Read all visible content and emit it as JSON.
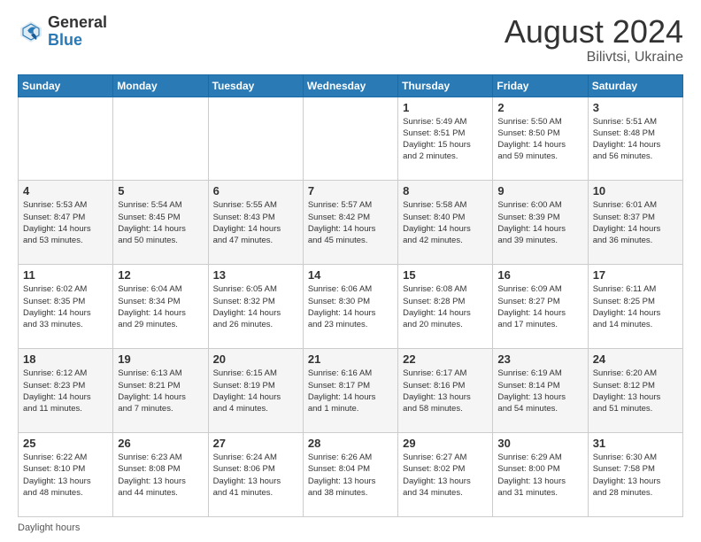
{
  "logo": {
    "general": "General",
    "blue": "Blue"
  },
  "header": {
    "month_year": "August 2024",
    "location": "Bilivtsi, Ukraine"
  },
  "days_of_week": [
    "Sunday",
    "Monday",
    "Tuesday",
    "Wednesday",
    "Thursday",
    "Friday",
    "Saturday"
  ],
  "footer": {
    "daylight_label": "Daylight hours"
  },
  "weeks": [
    [
      {
        "day": "",
        "info": ""
      },
      {
        "day": "",
        "info": ""
      },
      {
        "day": "",
        "info": ""
      },
      {
        "day": "",
        "info": ""
      },
      {
        "day": "1",
        "info": "Sunrise: 5:49 AM\nSunset: 8:51 PM\nDaylight: 15 hours\nand 2 minutes."
      },
      {
        "day": "2",
        "info": "Sunrise: 5:50 AM\nSunset: 8:50 PM\nDaylight: 14 hours\nand 59 minutes."
      },
      {
        "day": "3",
        "info": "Sunrise: 5:51 AM\nSunset: 8:48 PM\nDaylight: 14 hours\nand 56 minutes."
      }
    ],
    [
      {
        "day": "4",
        "info": "Sunrise: 5:53 AM\nSunset: 8:47 PM\nDaylight: 14 hours\nand 53 minutes."
      },
      {
        "day": "5",
        "info": "Sunrise: 5:54 AM\nSunset: 8:45 PM\nDaylight: 14 hours\nand 50 minutes."
      },
      {
        "day": "6",
        "info": "Sunrise: 5:55 AM\nSunset: 8:43 PM\nDaylight: 14 hours\nand 47 minutes."
      },
      {
        "day": "7",
        "info": "Sunrise: 5:57 AM\nSunset: 8:42 PM\nDaylight: 14 hours\nand 45 minutes."
      },
      {
        "day": "8",
        "info": "Sunrise: 5:58 AM\nSunset: 8:40 PM\nDaylight: 14 hours\nand 42 minutes."
      },
      {
        "day": "9",
        "info": "Sunrise: 6:00 AM\nSunset: 8:39 PM\nDaylight: 14 hours\nand 39 minutes."
      },
      {
        "day": "10",
        "info": "Sunrise: 6:01 AM\nSunset: 8:37 PM\nDaylight: 14 hours\nand 36 minutes."
      }
    ],
    [
      {
        "day": "11",
        "info": "Sunrise: 6:02 AM\nSunset: 8:35 PM\nDaylight: 14 hours\nand 33 minutes."
      },
      {
        "day": "12",
        "info": "Sunrise: 6:04 AM\nSunset: 8:34 PM\nDaylight: 14 hours\nand 29 minutes."
      },
      {
        "day": "13",
        "info": "Sunrise: 6:05 AM\nSunset: 8:32 PM\nDaylight: 14 hours\nand 26 minutes."
      },
      {
        "day": "14",
        "info": "Sunrise: 6:06 AM\nSunset: 8:30 PM\nDaylight: 14 hours\nand 23 minutes."
      },
      {
        "day": "15",
        "info": "Sunrise: 6:08 AM\nSunset: 8:28 PM\nDaylight: 14 hours\nand 20 minutes."
      },
      {
        "day": "16",
        "info": "Sunrise: 6:09 AM\nSunset: 8:27 PM\nDaylight: 14 hours\nand 17 minutes."
      },
      {
        "day": "17",
        "info": "Sunrise: 6:11 AM\nSunset: 8:25 PM\nDaylight: 14 hours\nand 14 minutes."
      }
    ],
    [
      {
        "day": "18",
        "info": "Sunrise: 6:12 AM\nSunset: 8:23 PM\nDaylight: 14 hours\nand 11 minutes."
      },
      {
        "day": "19",
        "info": "Sunrise: 6:13 AM\nSunset: 8:21 PM\nDaylight: 14 hours\nand 7 minutes."
      },
      {
        "day": "20",
        "info": "Sunrise: 6:15 AM\nSunset: 8:19 PM\nDaylight: 14 hours\nand 4 minutes."
      },
      {
        "day": "21",
        "info": "Sunrise: 6:16 AM\nSunset: 8:17 PM\nDaylight: 14 hours\nand 1 minute."
      },
      {
        "day": "22",
        "info": "Sunrise: 6:17 AM\nSunset: 8:16 PM\nDaylight: 13 hours\nand 58 minutes."
      },
      {
        "day": "23",
        "info": "Sunrise: 6:19 AM\nSunset: 8:14 PM\nDaylight: 13 hours\nand 54 minutes."
      },
      {
        "day": "24",
        "info": "Sunrise: 6:20 AM\nSunset: 8:12 PM\nDaylight: 13 hours\nand 51 minutes."
      }
    ],
    [
      {
        "day": "25",
        "info": "Sunrise: 6:22 AM\nSunset: 8:10 PM\nDaylight: 13 hours\nand 48 minutes."
      },
      {
        "day": "26",
        "info": "Sunrise: 6:23 AM\nSunset: 8:08 PM\nDaylight: 13 hours\nand 44 minutes."
      },
      {
        "day": "27",
        "info": "Sunrise: 6:24 AM\nSunset: 8:06 PM\nDaylight: 13 hours\nand 41 minutes."
      },
      {
        "day": "28",
        "info": "Sunrise: 6:26 AM\nSunset: 8:04 PM\nDaylight: 13 hours\nand 38 minutes."
      },
      {
        "day": "29",
        "info": "Sunrise: 6:27 AM\nSunset: 8:02 PM\nDaylight: 13 hours\nand 34 minutes."
      },
      {
        "day": "30",
        "info": "Sunrise: 6:29 AM\nSunset: 8:00 PM\nDaylight: 13 hours\nand 31 minutes."
      },
      {
        "day": "31",
        "info": "Sunrise: 6:30 AM\nSunset: 7:58 PM\nDaylight: 13 hours\nand 28 minutes."
      }
    ]
  ]
}
